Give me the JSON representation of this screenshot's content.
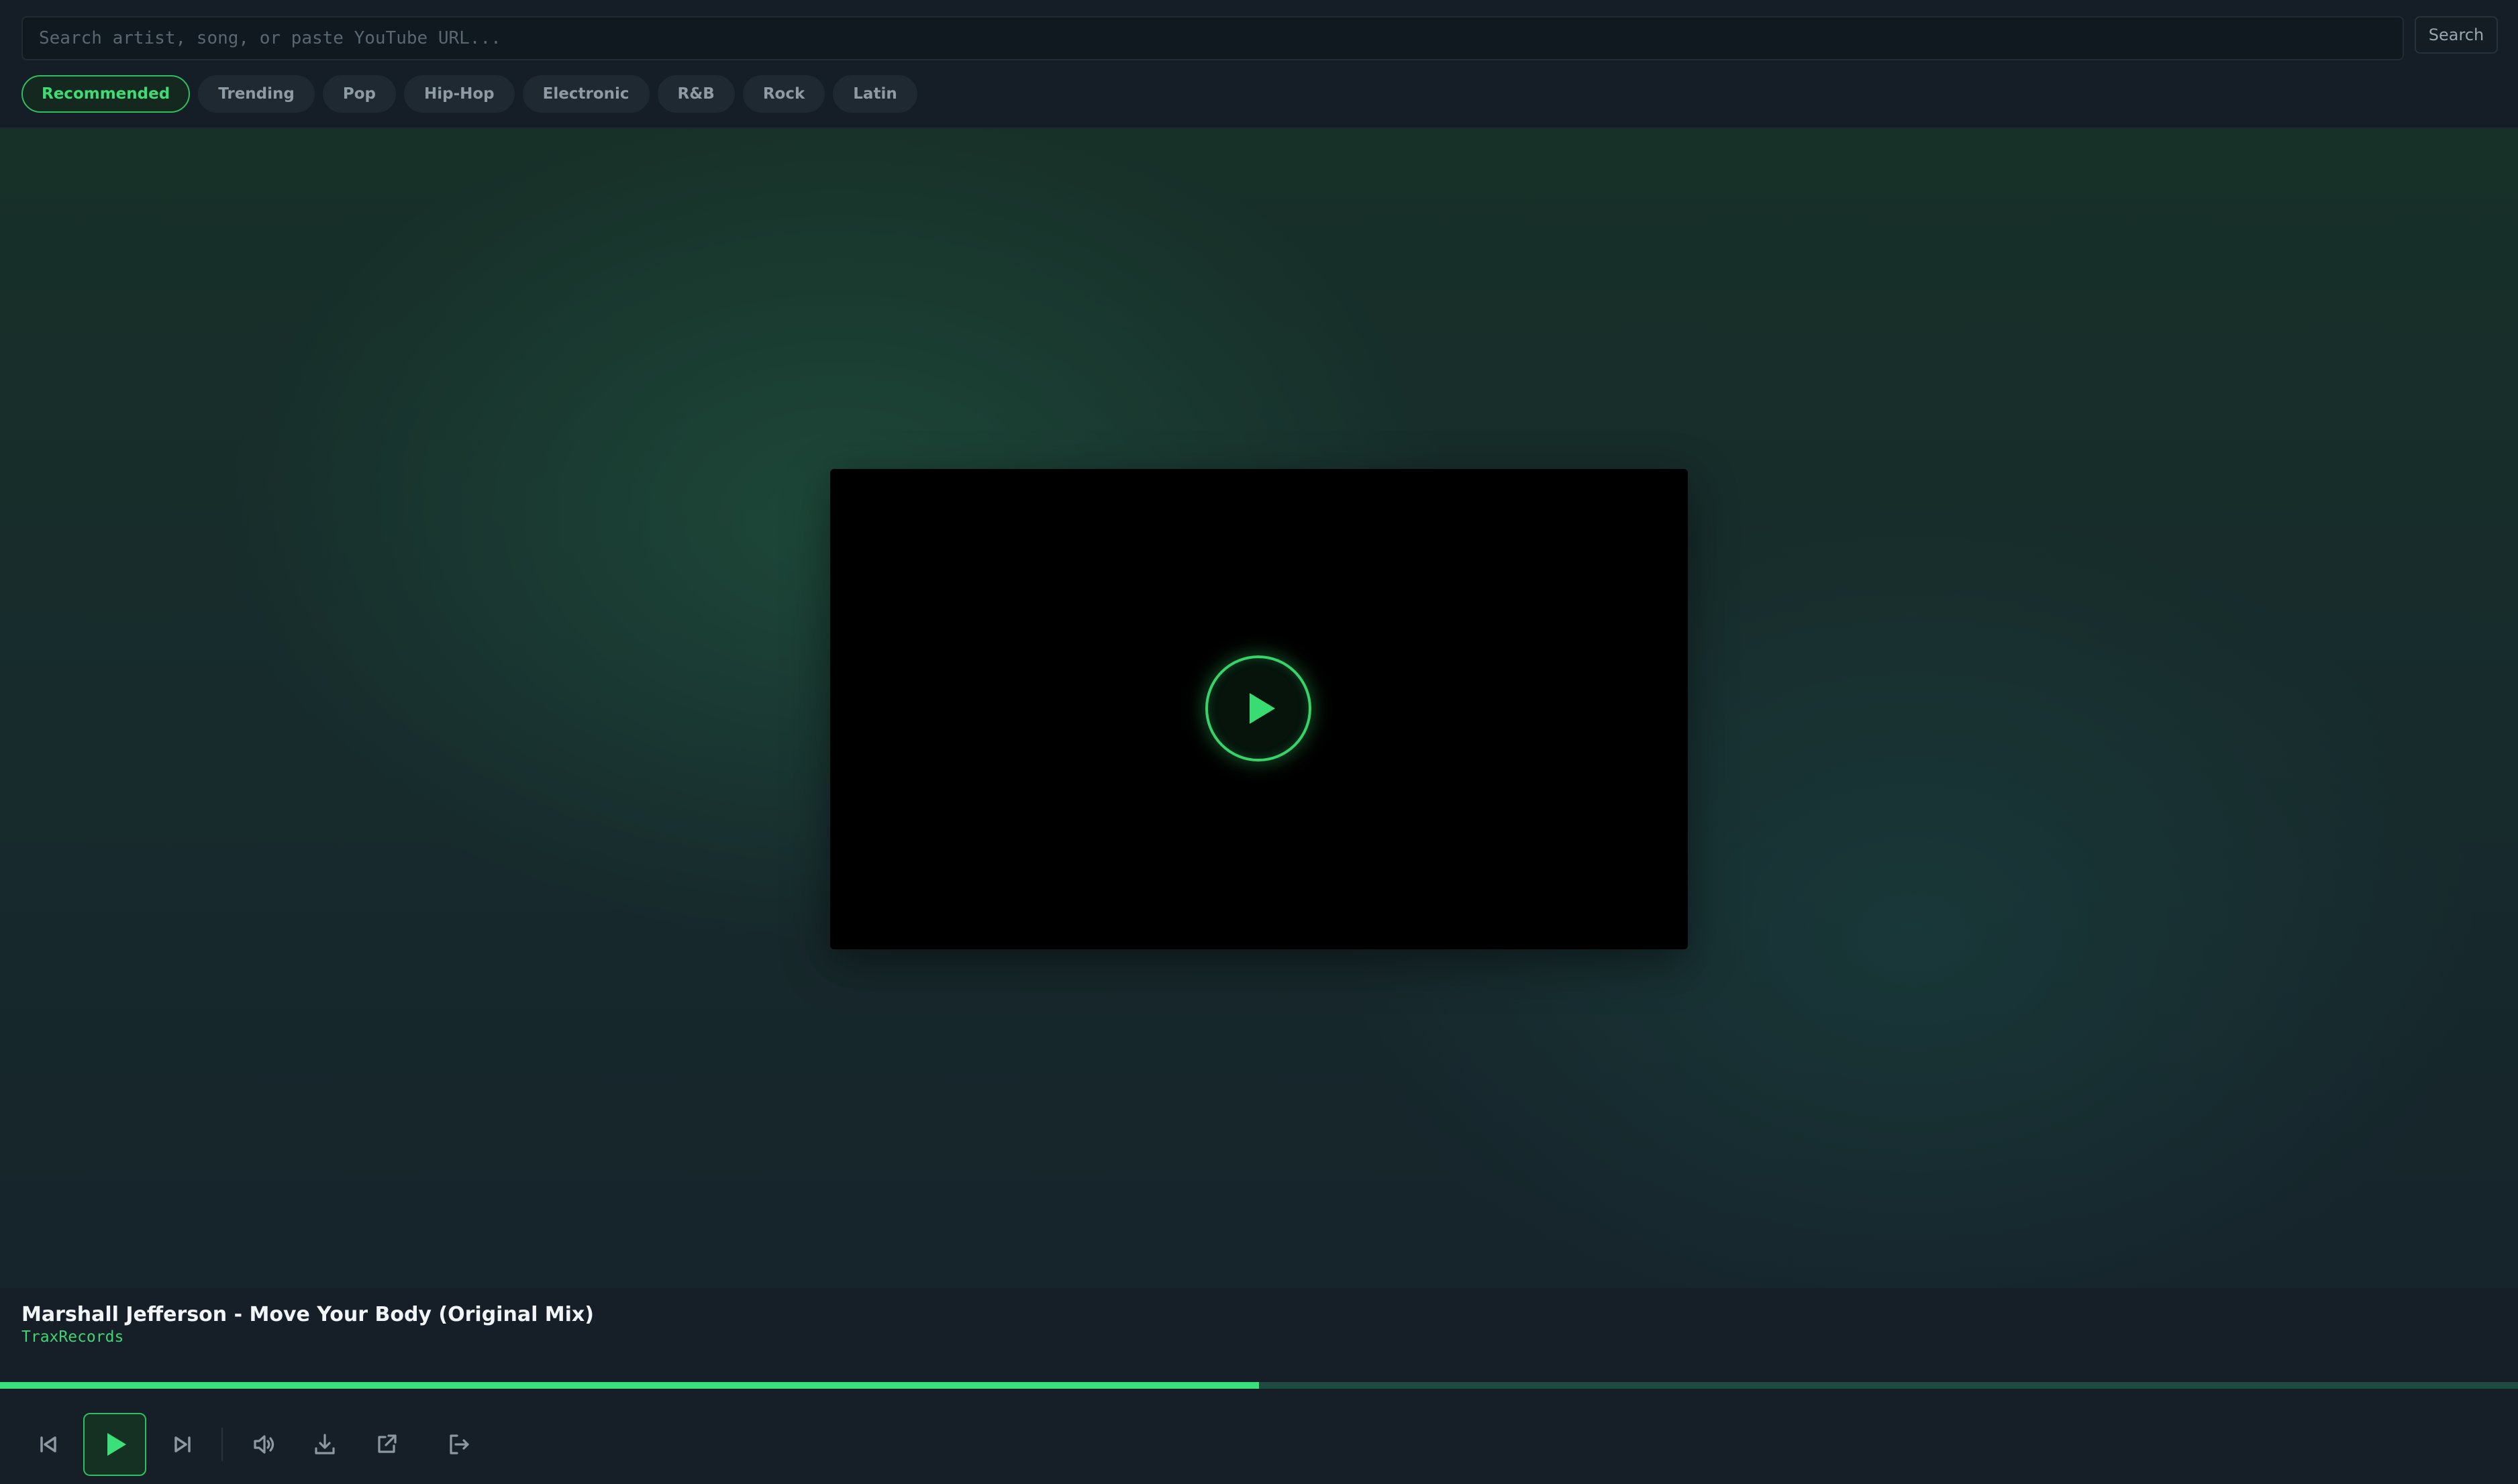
{
  "search": {
    "placeholder": "Search artist, song, or paste YouTube URL...",
    "value": "",
    "button_label": "Search"
  },
  "genres": [
    {
      "label": "Recommended",
      "active": true
    },
    {
      "label": "Trending",
      "active": false
    },
    {
      "label": "Pop",
      "active": false
    },
    {
      "label": "Hip-Hop",
      "active": false
    },
    {
      "label": "Electronic",
      "active": false
    },
    {
      "label": "R&B",
      "active": false
    },
    {
      "label": "Rock",
      "active": false
    },
    {
      "label": "Latin",
      "active": false
    }
  ],
  "player": {
    "video_overlay_icon": "play-icon",
    "track_title": "Marshall Jefferson - Move Your Body (Original Mix)",
    "channel": "TraxRecords",
    "progress_fraction": 0.5
  },
  "controls": [
    {
      "name": "previous",
      "icon": "skip-back-icon"
    },
    {
      "name": "play",
      "icon": "play-icon"
    },
    {
      "name": "next",
      "icon": "skip-forward-icon"
    },
    {
      "name": "volume",
      "icon": "volume-icon"
    },
    {
      "name": "download",
      "icon": "download-icon"
    },
    {
      "name": "open-external",
      "icon": "external-link-icon"
    },
    {
      "name": "exit",
      "icon": "exit-icon"
    }
  ],
  "colors": {
    "accent": "#3be07a",
    "background": "#141d25",
    "progress_track": "#1f4a3f"
  }
}
